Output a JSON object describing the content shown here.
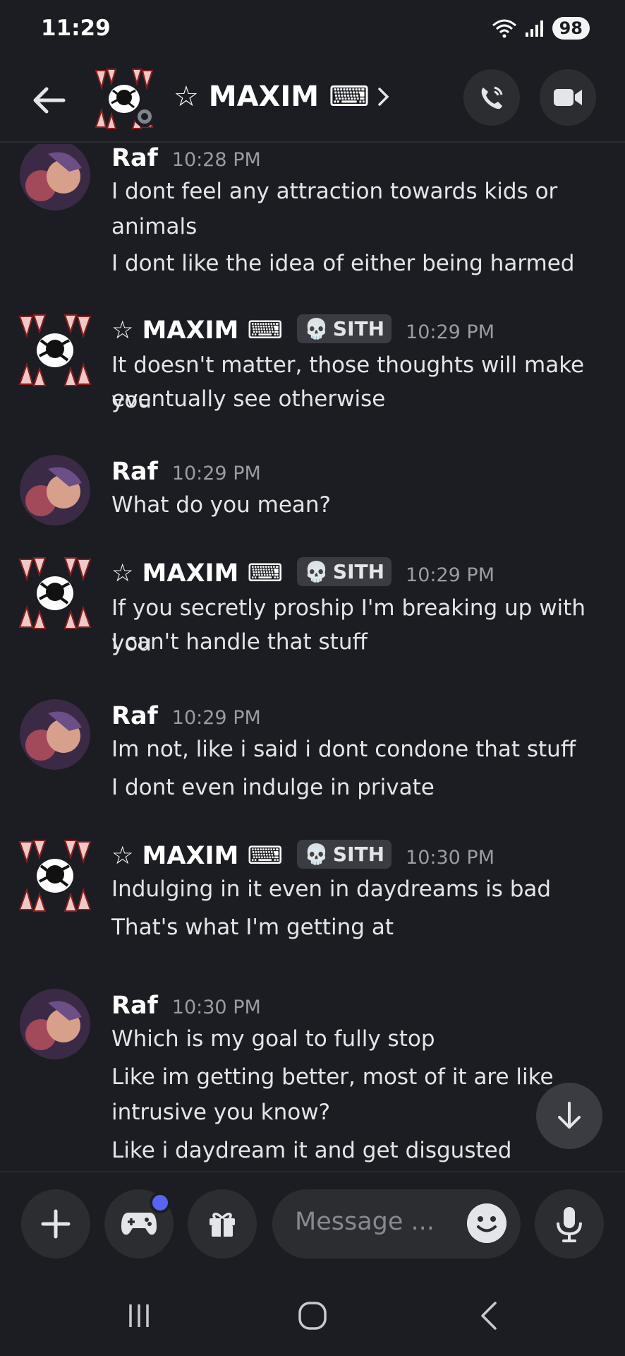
{
  "status_bar": {
    "time": "11:29",
    "battery": "98",
    "wifi_icon": "wifi-icon",
    "signal_icon": "signal-icon"
  },
  "header": {
    "back_icon": "arrow-left-icon",
    "channel_name": "☆ MAXIM ⌨",
    "chevron_icon": "chevron-right-icon",
    "call_icon": "phone-icon",
    "video_icon": "video-icon"
  },
  "messages": [
    {
      "author": "Raf",
      "timestamp": "10:28 PM",
      "lines": [
        "I dont feel any attraction towards kids or",
        "animals",
        "I dont like the idea of either being harmed"
      ]
    },
    {
      "author": "☆ MAXIM ⌨",
      "tag": "SITH",
      "timestamp": "10:29 PM",
      "lines": [
        "It doesn't matter, those thoughts will make you",
        "eventually see otherwise"
      ]
    },
    {
      "author": "Raf",
      "timestamp": "10:29 PM",
      "lines": [
        "What do you mean?"
      ]
    },
    {
      "author": "☆ MAXIM ⌨",
      "tag": "SITH",
      "timestamp": "10:29 PM",
      "lines": [
        "If you secretly proship I'm breaking up with you",
        "I can't handle that stuff"
      ]
    },
    {
      "author": "Raf",
      "timestamp": "10:29 PM",
      "lines": [
        "Im not, like i said i dont condone that stuff",
        "I dont even indulge in private"
      ]
    },
    {
      "author": "☆ MAXIM ⌨",
      "tag": "SITH",
      "timestamp": "10:30 PM",
      "lines": [
        "Indulging in it even in daydreams is bad",
        "That's what I'm getting at"
      ]
    },
    {
      "author": "Raf",
      "timestamp": "10:30 PM",
      "lines": [
        "Which is my goal to fully stop",
        "Like im getting better, most of it are like",
        "intrusive you know?",
        "Like i daydream it and get disgusted"
      ]
    }
  ],
  "composer": {
    "placeholder": "Message ...",
    "plus_icon": "plus-icon",
    "game_icon": "gamepad-icon",
    "gift_icon": "gift-icon",
    "emoji_icon": "emoji-icon",
    "mic_icon": "microphone-icon"
  },
  "navbar": {
    "recents_icon": "recents-icon",
    "home_icon": "home-icon",
    "back_icon": "back-icon"
  },
  "colors": {
    "background": "#1c1d22",
    "accent": "#5865f2",
    "surface": "#2b2d31"
  }
}
